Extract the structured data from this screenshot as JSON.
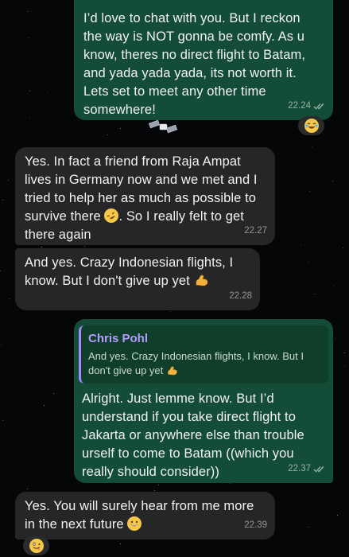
{
  "messages": [
    {
      "direction": "outgoing",
      "text": "I’d love to chat with you. But I reckon\nthe way is NOT gonna be comfy. As u\nknow, theres no direct flight to Batam,\nand yada yada yada, its not worth it.\nLets set to meet any other time\nsomewhere!",
      "time": "22.24",
      "reaction": "joy-emoji"
    },
    {
      "direction": "incoming",
      "text_before_emoji": "Yes. In fact a friend from Raja Ampat\nlives in Germany now and we met and I\ntried to help her as much as possible to\nsurvive there ",
      "emoji": "rofl-emoji",
      "text_after_emoji": ". So I really felt to get\nthere again",
      "time": "22.27"
    },
    {
      "direction": "incoming",
      "text": "And yes. Crazy Indonesian flights, I\nknow. But I don't give up yet",
      "emoji": "flexed-biceps-emoji",
      "time": "22.28"
    },
    {
      "direction": "outgoing",
      "quote": {
        "author": "Chris Pohl",
        "text": "And yes. Crazy Indonesian flights, I know. But I\ndon't give up yet",
        "emoji": "flexed-biceps-emoji"
      },
      "text": "Alright. Just lemme know. But I’d\nunderstand if you take direct flight to\nJakarta or anywhere else than trouble\nurself to come to Batam ((which you\nreally should consider))",
      "time": "22.37"
    },
    {
      "direction": "incoming",
      "text": "Yes. You will surely hear from me more\nin the next future",
      "emoji": "grinning-emoji",
      "time": "22.39",
      "reaction": "zany-face-emoji"
    }
  ],
  "colors": {
    "outgoing_bubble": "#144d37",
    "incoming_bubble": "#262628",
    "quote_accent": "#a78bfa",
    "background": "#050607"
  }
}
